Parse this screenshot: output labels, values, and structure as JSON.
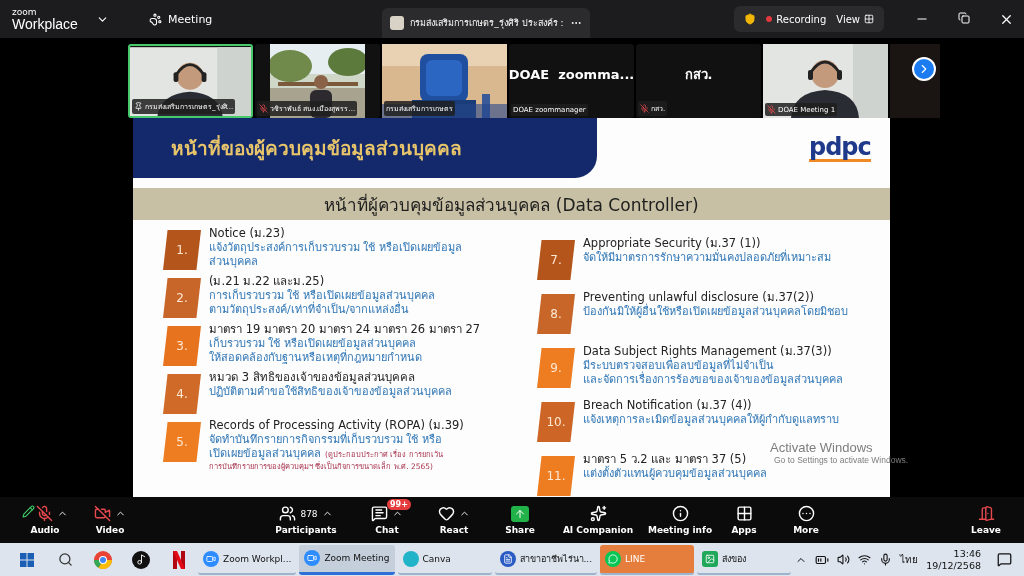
{
  "top_bar": {
    "logo_top": "zoom",
    "logo_bottom": "Workplace",
    "meeting_tab": "Meeting",
    "share_indicator": "กรมส่งเสริมการเกษตร_รุ่งศิริ ประสงค์ร :",
    "recording": "Recording",
    "view": "View"
  },
  "video_tiles": [
    {
      "kind": "video",
      "name": "กรมส่งเสริมการเกษตร_รุ่งศิ...",
      "pinned": true,
      "muted": false,
      "active": true
    },
    {
      "kind": "video",
      "name": "วชิราพันธ์ สนง.เมืองสุพรร...",
      "pinned": false,
      "muted": true,
      "active": false
    },
    {
      "kind": "video",
      "name": "กรมส่งเสริมการเกษตร",
      "pinned": false,
      "muted": false,
      "active": false
    },
    {
      "kind": "name_only",
      "display": "DOAE  zoomma...",
      "name": "DOAE zoommanager",
      "pinned": false,
      "muted": false,
      "active": false
    },
    {
      "kind": "name_only",
      "display": "กสว.",
      "name": "กสว.",
      "pinned": false,
      "muted": true,
      "active": false
    },
    {
      "kind": "video",
      "name": "DOAE Meeting 1",
      "pinned": false,
      "muted": true,
      "active": false
    }
  ],
  "slide": {
    "banner": "หน้าที่ของผู้ควบคุมข้อมูลส่วนบุคคล",
    "logo": "pdpc",
    "heading": "หน้าที่ผู้ควบคุมข้อมูลส่วนบุคคล (Data Controller)",
    "columns": [
      [
        {
          "number": "1.",
          "title": "Notice (ม.23)",
          "lines": [
            "แจ้งวัตถุประสงค์การเก็บรวบรวม ใช้ หรือเปิดเผยข้อมูล",
            "ส่วนบุคคล"
          ],
          "color": "#b4551c"
        },
        {
          "number": "2.",
          "title": "(ม.21 ม.22 และม.25)",
          "lines": [
            "การเก็บรวบรวม ใช้ หรือเปิดเผยข้อมูลส่วนบุคคล",
            "ตามวัตถุประสงค์/เท่าที่จำเป็น/จากแหล่งอื่น"
          ],
          "color": "#c8662a"
        },
        {
          "number": "3.",
          "title": "มาตรา 19 มาตรา 20 มาตรา 24 มาตรา 26 มาตรา 27",
          "lines": [
            "เก็บรวบรวม ใช้ หรือเปิดเผยข้อมูลส่วนบุคคล",
            "ให้สอดคล้องกับฐานหรือเหตุที่กฎหมายกำหนด"
          ],
          "color": "#e8731f"
        },
        {
          "number": "4.",
          "title": "หมวด 3 สิทธิของเจ้าของข้อมูลส่วนบุคคล",
          "lines": [
            "ปฏิบัติตามคำขอใช้สิทธิของเจ้าของข้อมูลส่วนบุคคล"
          ],
          "color": "#d06a28"
        },
        {
          "number": "5.",
          "title": "Records of Processing Activity (ROPA) (ม.39)",
          "lines": [
            "จัดทำบันทึกรายการกิจกรรมที่เก็บรวบรวม ใช้ หรือ",
            "เปิดเผยข้อมูลส่วนบุคคล"
          ],
          "note": [
            "(ดูประกอบประกาศ เรื่อง การยกเว้น",
            "การบันทึกรายการของผู้ควบคุมฯ ซึ่งเป็นกิจการขนาดเล็ก พ.ศ. 2565)"
          ],
          "color": "#ee7d22"
        }
      ],
      [
        {
          "number": "7.",
          "title": "Appropriate Security (ม.37 (1))",
          "lines": [
            "จัดให้มีมาตรการรักษาความมั่นคงปลอดภัยที่เหมาะสม"
          ],
          "color": "#b4551c"
        },
        {
          "number": "8.",
          "title": "Preventing unlawful disclosure (ม.37(2))",
          "lines": [
            "ป้องกันมิให้ผู้อื่นใช้หรือเปิดเผยข้อมูลส่วนบุคคลโดยมิชอบ"
          ],
          "color": "#c8662a"
        },
        {
          "number": "9.",
          "title": "Data Subject Rights Management (ม.37(3))",
          "lines": [
            "มีระบบตรวจสอบเพื่อลบข้อมูลที่ไม่จำเป็น",
            "และจัดการเรื่องการร้องขอของเจ้าของข้อมูลส่วนบุคคล"
          ],
          "color": "#ee7d22"
        },
        {
          "number": "10.",
          "title": "Breach Notification (ม.37 (4))",
          "lines": [
            "แจ้งเหตุการละเมิดข้อมูลส่วนบุคคลให้ผู้กำกับดูแลทราบ"
          ],
          "color": "#cc6526"
        },
        {
          "number": "11.",
          "title": "มาตรา 5 ว.2 และ มาตรา 37 (5)",
          "lines": [
            "แต่งตั้งตัวแทนผู้ควบคุมข้อมูลส่วนบุคคล"
          ],
          "color": "#ee7d22"
        }
      ]
    ]
  },
  "toolbar": [
    {
      "kind": "audio",
      "label": "Audio",
      "caret": true
    },
    {
      "kind": "video",
      "label": "Video",
      "caret": true
    },
    {
      "kind": "participants",
      "label": "Participants",
      "count": "878",
      "caret": true
    },
    {
      "kind": "chat",
      "label": "Chat",
      "badge": "99+",
      "caret": true
    },
    {
      "kind": "react",
      "label": "React",
      "caret": true
    },
    {
      "kind": "share",
      "label": "Share",
      "caret": false
    },
    {
      "kind": "ai",
      "label": "AI Companion",
      "caret": false
    },
    {
      "kind": "info",
      "label": "Meeting info",
      "caret": false
    },
    {
      "kind": "apps",
      "label": "Apps",
      "caret": false
    },
    {
      "kind": "more",
      "label": "More",
      "caret": false
    },
    {
      "kind": "leave",
      "label": "Leave",
      "caret": false
    }
  ],
  "watermark": {
    "line1": "Activate Windows",
    "line2": "Go to Settings to activate Windows."
  },
  "taskbar": {
    "apps": [
      {
        "kind": "windows"
      },
      {
        "kind": "search"
      },
      {
        "kind": "chrome"
      },
      {
        "kind": "tiktok"
      },
      {
        "kind": "netflix"
      },
      {
        "kind": "zoom",
        "label": "Zoom Workpl...",
        "selected": false,
        "attention": false
      },
      {
        "kind": "zoom",
        "label": "Zoom Meeting",
        "selected": true,
        "attention": false
      },
      {
        "kind": "canva",
        "label": "Canva",
        "selected": false,
        "attention": false
      },
      {
        "kind": "word",
        "label": "สาขาอาชีพไร่นา...",
        "selected": false,
        "attention": false
      },
      {
        "kind": "line",
        "label": "LINE",
        "selected": false,
        "attention": true
      },
      {
        "label": "ส่งของ",
        "selected": false,
        "attention": false
      }
    ],
    "language": "ไทย",
    "time": "13:46",
    "date": "19/12/2568"
  }
}
